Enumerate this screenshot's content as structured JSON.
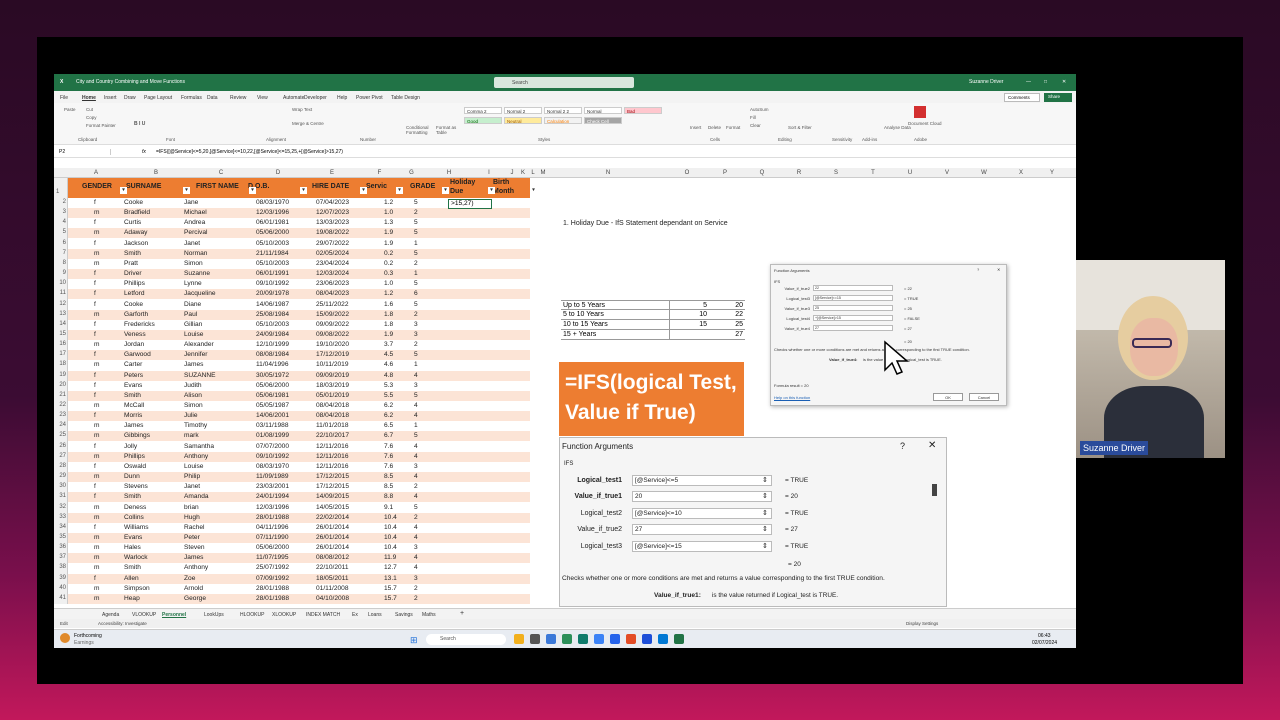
{
  "window": {
    "title": "City and Country Combining and Move Functions",
    "search": "Search",
    "user": "Suzanne Driver",
    "comments": "Comments",
    "share": "Share"
  },
  "menu": [
    "File",
    "Home",
    "Insert",
    "Draw",
    "Page Layout",
    "Formulas",
    "Data",
    "Review",
    "View",
    "Automate",
    "Developer",
    "Help",
    "Power Pivot",
    "Table Design"
  ],
  "ribbon": {
    "paste": "Paste",
    "cut": "Cut",
    "copy": "Copy",
    "format_painter": "Format Painter",
    "clipboard": "Clipboard",
    "font": "Font",
    "alignment": "Alignment",
    "number": "Number",
    "wrap_text": "Wrap Text",
    "merge_center": "Merge & Centre",
    "conditional": "Conditional Formatting",
    "format_table": "Format as Table",
    "styles_label": "Styles",
    "styles": [
      "Comma 2",
      "Normal 2",
      "Normal 2 2",
      "Normal",
      "Bad",
      "Good",
      "Neutral",
      "Calculation",
      "Check Cell"
    ],
    "insert": "Insert",
    "delete": "Delete",
    "format": "Format",
    "cells": "Cells",
    "autosum": "AutoSum",
    "fill": "Fill",
    "clear": "Clear",
    "sort": "Sort & Filter",
    "find": "Find & Select",
    "editing": "Editing",
    "sensitivity": "Sensitivity",
    "addins": "Add-ins",
    "analyse": "Analyse Data",
    "document_cloud": "Document Cloud",
    "adobe": "Adobe"
  },
  "formula_bar": {
    "name_box": "P2",
    "formula": "=IFS([@Service]<=5,20,[@Service]<=10,22,[@Service]<=15,25,+[@Service]>15,27)"
  },
  "columns": [
    "A",
    "B",
    "C",
    "D",
    "E",
    "F",
    "G",
    "H",
    "I",
    "J",
    "K",
    "L",
    "M",
    "N",
    "O",
    "P",
    "Q",
    "R",
    "S",
    "T",
    "U",
    "V",
    "W",
    "X",
    "Y"
  ],
  "table_headers": [
    "GENDER",
    "SURNAME",
    "FIRST NAME",
    "D.O.B.",
    "HIRE DATE",
    "Servic",
    "GRADE",
    "Holiday Due",
    "Birth Month"
  ],
  "editing_cell": ">15,27)",
  "rows": [
    [
      "f",
      "Cooke",
      "Jane",
      "08/03/1970",
      "07/04/2023",
      "1.2",
      "5"
    ],
    [
      "m",
      "Bradfield",
      "Michael",
      "12/03/1996",
      "12/07/2023",
      "1.0",
      "2"
    ],
    [
      "f",
      "Curtis",
      "Andrea",
      "06/01/1981",
      "13/03/2023",
      "1.3",
      "5"
    ],
    [
      "m",
      "Adaway",
      "Percival",
      "05/06/2000",
      "19/08/2022",
      "1.9",
      "5"
    ],
    [
      "f",
      "Jackson",
      "Janet",
      "05/10/2003",
      "29/07/2022",
      "1.9",
      "1"
    ],
    [
      "m",
      "Smith",
      "Norman",
      "21/11/1984",
      "02/05/2024",
      "0.2",
      "5"
    ],
    [
      "m",
      "Pratt",
      "Simon",
      "05/10/2003",
      "23/04/2024",
      "0.2",
      "2"
    ],
    [
      "f",
      "Driver",
      "Suzanne",
      "06/01/1991",
      "12/03/2024",
      "0.3",
      "1"
    ],
    [
      "f",
      "Phillips",
      "Lynne",
      "09/10/1992",
      "23/06/2023",
      "1.0",
      "5"
    ],
    [
      "f",
      "Letford",
      "Jacqueline",
      "20/09/1978",
      "08/04/2023",
      "1.2",
      "6"
    ],
    [
      "f",
      "Cooke",
      "Diane",
      "14/06/1987",
      "25/11/2022",
      "1.6",
      "5"
    ],
    [
      "m",
      "Garforth",
      "Paul",
      "25/08/1984",
      "15/09/2022",
      "1.8",
      "2"
    ],
    [
      "f",
      "Fredericks",
      "Gillian",
      "05/10/2003",
      "09/09/2022",
      "1.8",
      "3"
    ],
    [
      "f",
      "Veness",
      "Louise",
      "24/09/1984",
      "09/08/2022",
      "1.9",
      "3"
    ],
    [
      "m",
      "Jordan",
      "Alexander",
      "12/10/1999",
      "19/10/2020",
      "3.7",
      "2"
    ],
    [
      "f",
      "Garwood",
      "Jennifer",
      "08/08/1984",
      "17/12/2019",
      "4.5",
      "5"
    ],
    [
      "m",
      "Carter",
      "James",
      "11/04/1996",
      "10/11/2019",
      "4.6",
      "1"
    ],
    [
      "f",
      "Peters",
      "SUZANNE",
      "30/05/1972",
      "09/09/2019",
      "4.8",
      "4"
    ],
    [
      "f",
      "Evans",
      "Judith",
      "05/06/2000",
      "18/03/2019",
      "5.3",
      "3"
    ],
    [
      "f",
      "Smith",
      "Alison",
      "05/06/1981",
      "05/01/2019",
      "5.5",
      "5"
    ],
    [
      "m",
      "McCall",
      "Simon",
      "05/05/1987",
      "08/04/2018",
      "6.2",
      "4"
    ],
    [
      "f",
      "Morris",
      "Julie",
      "14/06/2001",
      "08/04/2018",
      "6.2",
      "4"
    ],
    [
      "m",
      "James",
      "Timothy",
      "03/11/1988",
      "11/01/2018",
      "6.5",
      "1"
    ],
    [
      "m",
      "Gibbings",
      "mark",
      "01/08/1999",
      "22/10/2017",
      "6.7",
      "5"
    ],
    [
      "f",
      "Jolly",
      "Samantha",
      "07/07/2000",
      "12/11/2016",
      "7.6",
      "4"
    ],
    [
      "m",
      "Phillips",
      "Anthony",
      "09/10/1992",
      "12/11/2016",
      "7.6",
      "4"
    ],
    [
      "f",
      "Oswald",
      "Louise",
      "08/03/1970",
      "12/11/2016",
      "7.6",
      "3"
    ],
    [
      "m",
      "Dunn",
      "Philip",
      "11/09/1989",
      "17/12/2015",
      "8.5",
      "4"
    ],
    [
      "f",
      "Stevens",
      "Janet",
      "23/03/2001",
      "17/12/2015",
      "8.5",
      "2"
    ],
    [
      "f",
      "Smith",
      "Amanda",
      "24/01/1994",
      "14/09/2015",
      "8.8",
      "4"
    ],
    [
      "m",
      "Deness",
      "brian",
      "12/03/1996",
      "14/05/2015",
      "9.1",
      "5"
    ],
    [
      "m",
      "Collins",
      "Hugh",
      "28/01/1988",
      "22/02/2014",
      "10.4",
      "2"
    ],
    [
      "f",
      "Williams",
      "Rachel",
      "04/11/1996",
      "26/01/2014",
      "10.4",
      "4"
    ],
    [
      "m",
      "Evans",
      "Peter",
      "07/11/1990",
      "26/01/2014",
      "10.4",
      "4"
    ],
    [
      "m",
      "Hales",
      "Steven",
      "05/06/2000",
      "26/01/2014",
      "10.4",
      "3"
    ],
    [
      "m",
      "Warlock",
      "James",
      "11/07/1995",
      "08/08/2012",
      "11.9",
      "4"
    ],
    [
      "m",
      "Smith",
      "Anthony",
      "25/07/1992",
      "22/10/2011",
      "12.7",
      "4"
    ],
    [
      "f",
      "Allen",
      "Zoe",
      "07/09/1992",
      "18/05/2011",
      "13.1",
      "3"
    ],
    [
      "m",
      "Simpson",
      "Arnold",
      "28/01/1988",
      "01/11/2008",
      "15.7",
      "2"
    ],
    [
      "m",
      "Heap",
      "George",
      "28/01/1988",
      "04/10/2008",
      "15.7",
      "2"
    ]
  ],
  "heading_note": "1. Holiday Due - IfS Statement dependant on Service",
  "lookup_table": [
    [
      "Up to 5 Years",
      "5",
      "20"
    ],
    [
      "5 to 10 Years",
      "10",
      "22"
    ],
    [
      "10 to 15 Years",
      "15",
      "25"
    ],
    [
      "15 + Years",
      "",
      "27"
    ]
  ],
  "ifs_banner": "=IFS(logical Test, Value if True)",
  "dialog_big": {
    "title": "Function Arguments",
    "func": "IFS",
    "args": [
      {
        "label": "Logical_test1",
        "value": "[@Service]<=5",
        "result": "TRUE"
      },
      {
        "label": "Value_if_true1",
        "value": "20",
        "result": "20"
      },
      {
        "label": "Logical_test2",
        "value": "[@Service]<=10",
        "result": "TRUE"
      },
      {
        "label": "Value_if_true2",
        "value": "27",
        "result": "27"
      },
      {
        "label": "Logical_test3",
        "value": "[@Service]<=15",
        "result": "TRUE"
      }
    ],
    "result_line": "= 20",
    "description": "Checks whether one or more conditions are met and returns a value corresponding to the first TRUE condition.",
    "arg_name": "Value_if_true1:",
    "arg_help": "is the value returned if Logical_test is TRUE."
  },
  "dialog_small": {
    "title": "Function Arguments",
    "func": "IFS",
    "args": [
      {
        "label": "Value_if_true2",
        "value": "22",
        "result": "22"
      },
      {
        "label": "Logical_test3",
        "value": "[@Service]<=15",
        "result": "TRUE"
      },
      {
        "label": "Value_if_true3",
        "value": "25",
        "result": "25"
      },
      {
        "label": "Logical_test4",
        "value": "+[@Service]>15",
        "result": "FALSE"
      },
      {
        "label": "Value_if_true4",
        "value": "27",
        "result": "27"
      }
    ],
    "result_line": "= 20",
    "description": "Checks whether one or more conditions are met and returns a value corresponding to the first TRUE condition.",
    "arg_name": "Value_if_true4:",
    "arg_help": "is the value returned if Logical_test is TRUE.",
    "formula_result": "Formula result = 20",
    "help": "Help on this function",
    "ok": "OK",
    "cancel": "Cancel"
  },
  "sheets": [
    "Agenda",
    "VLOOKUP",
    "Personnel",
    "LookUps",
    "HLOOKUP",
    "XLOOKUP",
    "INDEX MATCH",
    "Ex",
    "Loans",
    "Savings",
    "Maths"
  ],
  "status": {
    "mode": "Edit",
    "accessibility": "Accessibility: Investigate",
    "display": "Display Settings"
  },
  "taskbar": {
    "weather": "Forthcoming",
    "weather_sub": "Earnings",
    "search": "Search",
    "time": "06:43",
    "date": "02/07/2024"
  },
  "webcam": {
    "name": "Suzanne Driver"
  },
  "colors": {
    "excel_green": "#217346",
    "header_orange": "#ed7d31",
    "band": "#fce4d6"
  }
}
